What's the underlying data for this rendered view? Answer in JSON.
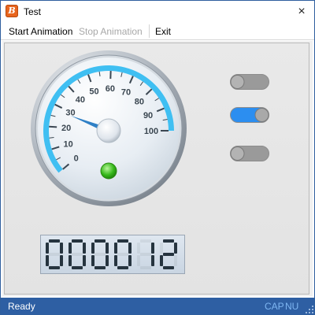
{
  "window": {
    "title": "Test",
    "close_glyph": "×",
    "app_icon_letter": "B",
    "app_icon": "app-logo-icon"
  },
  "menu": {
    "start": "Start Animation",
    "stop": "Stop Animation",
    "exit": "Exit"
  },
  "gauge": {
    "min": 0,
    "max": 100,
    "labels": [
      "0",
      "10",
      "20",
      "30",
      "40",
      "50",
      "60",
      "70",
      "80",
      "90",
      "100"
    ],
    "value": 28,
    "indicator_color": "#35b81a",
    "accent_color": "#3fbff2"
  },
  "toggles": [
    {
      "on": false
    },
    {
      "on": true
    },
    {
      "on": false
    }
  ],
  "counter": {
    "digits": "000012",
    "segment_color": "#26343f"
  },
  "status": {
    "text": "Ready",
    "indicators": [
      "CAP",
      "NU"
    ]
  },
  "colors": {
    "status_bar": "#2e5fa3",
    "toggle_on": "#2c8ef0",
    "toggle_off": "#9a9a9a"
  }
}
